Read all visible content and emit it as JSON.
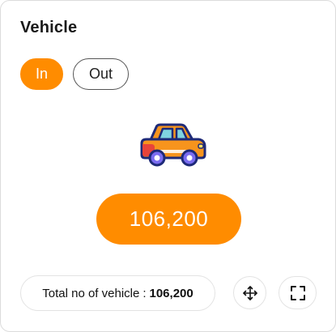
{
  "card": {
    "title": "Vehicle"
  },
  "toggle": {
    "options": [
      "In",
      "Out"
    ],
    "selected": "In"
  },
  "icon": {
    "name": "car-icon"
  },
  "summary": {
    "value": "106,200",
    "total_label": "Total no of vehicle",
    "total_separator": ":",
    "total_value": "106,200"
  },
  "actions": {
    "move_icon": "move-icon",
    "expand_icon": "expand-icon"
  },
  "colors": {
    "accent": "#ff8c00",
    "car_body": "#f7941d",
    "car_window": "#7fd4e0",
    "car_wheel": "#7a6cf0",
    "car_accent_red": "#e8443a",
    "outline": "#1e2a78"
  }
}
